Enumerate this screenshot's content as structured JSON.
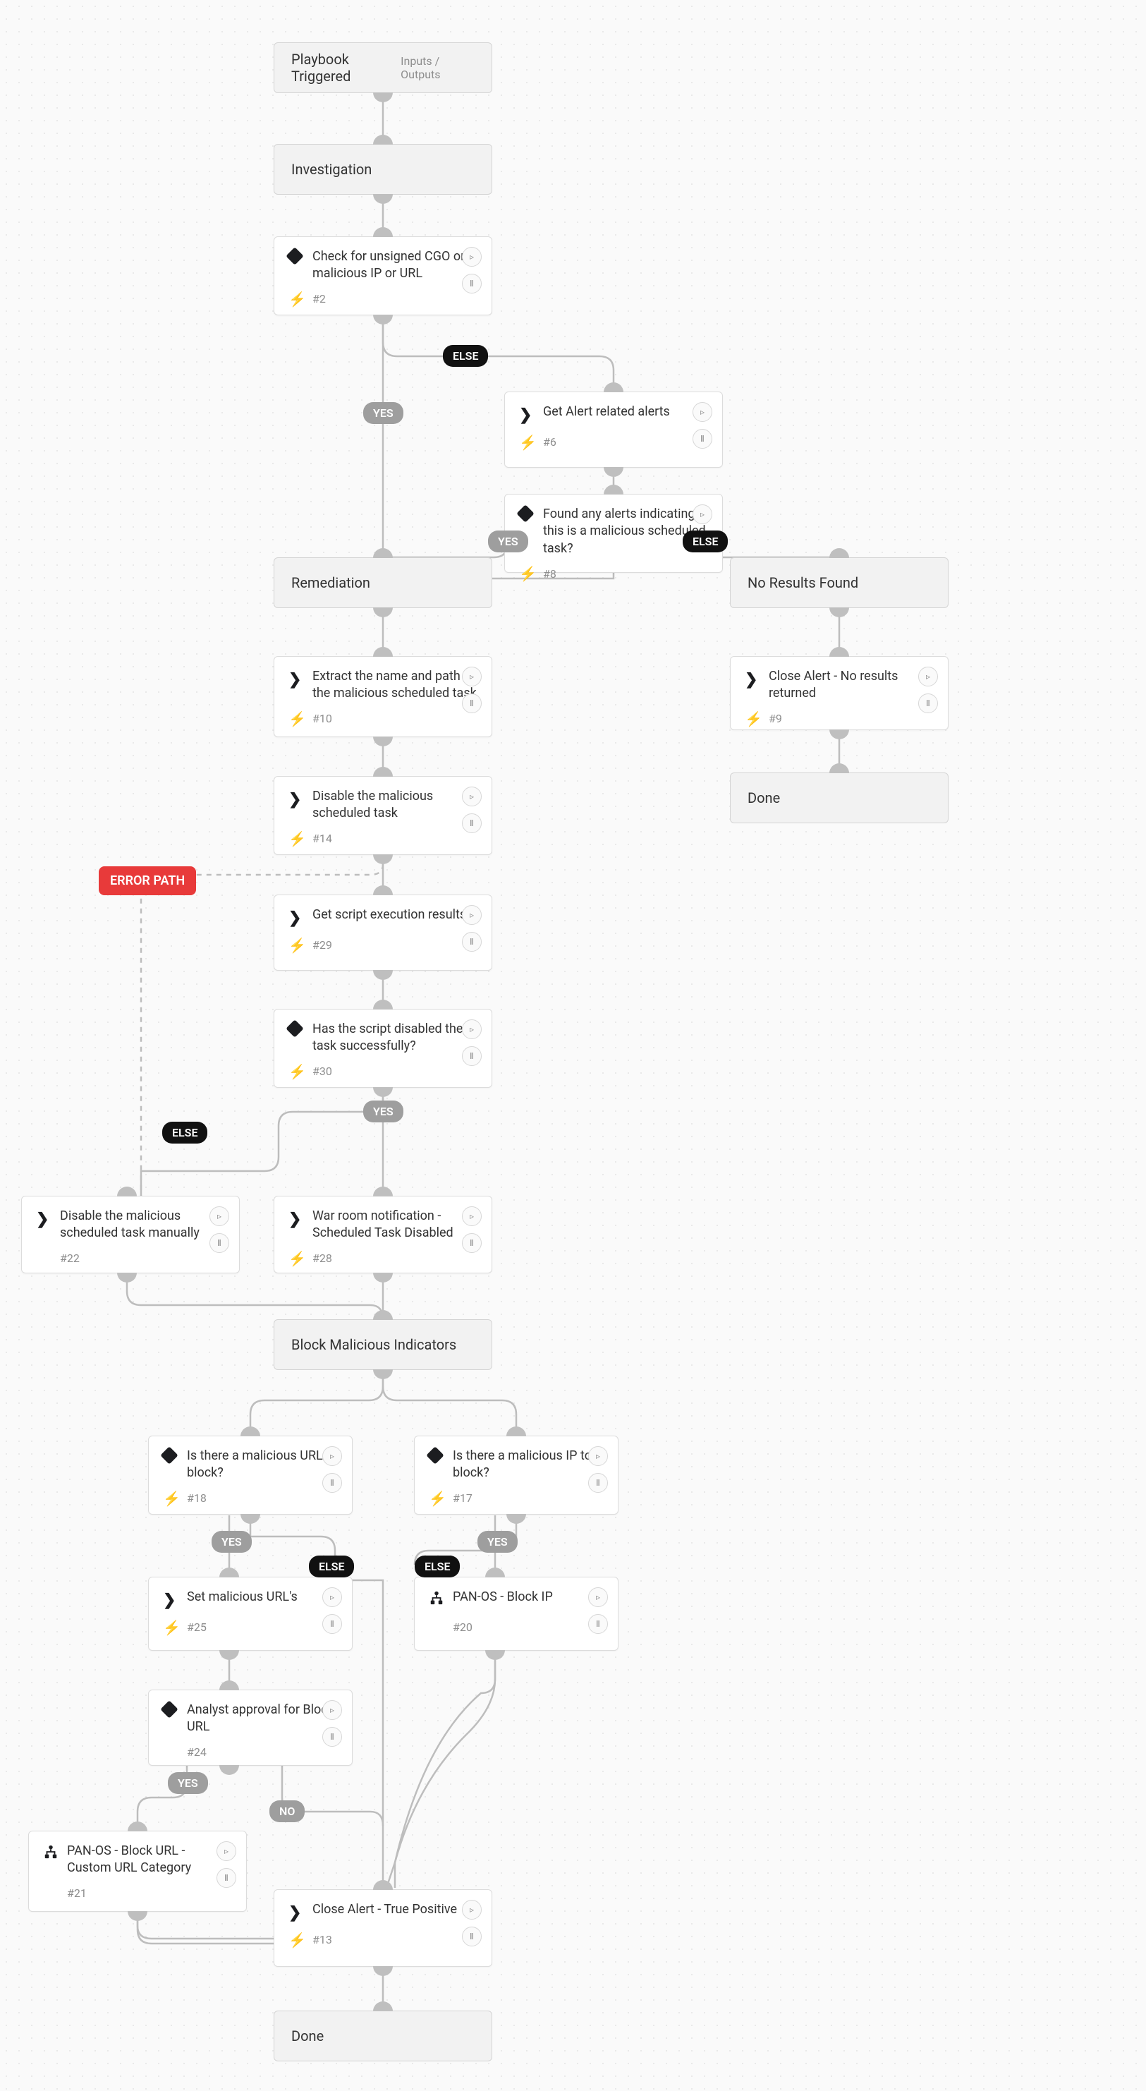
{
  "chart_data": {
    "type": "flowchart",
    "nodes": [
      {
        "id": "start",
        "kind": "section",
        "label": "Playbook Triggered",
        "right": "Inputs / Outputs"
      },
      {
        "id": "investigation",
        "kind": "section",
        "label": "Investigation"
      },
      {
        "id": "n2",
        "kind": "condition",
        "label": "Check for unsigned CGO or malicious IP or URL",
        "tid": "#2"
      },
      {
        "id": "n6",
        "kind": "task",
        "label": "Get Alert related alerts",
        "tid": "#6"
      },
      {
        "id": "n8",
        "kind": "condition",
        "label": "Found any alerts indicating this is a malicious scheduled task?",
        "tid": "#8"
      },
      {
        "id": "remediation",
        "kind": "section",
        "label": "Remediation"
      },
      {
        "id": "noresults",
        "kind": "section",
        "label": "No Results Found"
      },
      {
        "id": "n10",
        "kind": "task",
        "label": "Extract the name and path of the malicious scheduled task",
        "tid": "#10"
      },
      {
        "id": "n9",
        "kind": "task",
        "label": "Close Alert - No results returned",
        "tid": "#9"
      },
      {
        "id": "done_r",
        "kind": "section",
        "label": "Done"
      },
      {
        "id": "n14",
        "kind": "task",
        "label": "Disable the malicious scheduled task",
        "tid": "#14"
      },
      {
        "id": "n29",
        "kind": "task",
        "label": "Get script execution results",
        "tid": "#29"
      },
      {
        "id": "n30",
        "kind": "condition",
        "label": "Has the script disabled the task successfully?",
        "tid": "#30"
      },
      {
        "id": "n22",
        "kind": "task",
        "label": "Disable the malicious scheduled task manually",
        "tid": "#22"
      },
      {
        "id": "n28",
        "kind": "task",
        "label": "War room notification - Scheduled Task Disabled",
        "tid": "#28"
      },
      {
        "id": "blockind",
        "kind": "section",
        "label": "Block Malicious Indicators"
      },
      {
        "id": "n18",
        "kind": "condition",
        "label": "Is there a malicious URL to block?",
        "tid": "#18"
      },
      {
        "id": "n17",
        "kind": "condition",
        "label": "Is there a malicious IP to block?",
        "tid": "#17"
      },
      {
        "id": "n25",
        "kind": "task",
        "label": "Set malicious URL's",
        "tid": "#25"
      },
      {
        "id": "n20",
        "kind": "subplay",
        "label": "PAN-OS - Block IP",
        "tid": "#20"
      },
      {
        "id": "n24",
        "kind": "condition",
        "label": "Analyst approval for Block URL",
        "tid": "#24"
      },
      {
        "id": "n21",
        "kind": "subplay",
        "label": "PAN-OS - Block URL - Custom URL Category",
        "tid": "#21"
      },
      {
        "id": "n13",
        "kind": "task",
        "label": "Close Alert - True Positive",
        "tid": "#13"
      },
      {
        "id": "done",
        "kind": "section",
        "label": "Done"
      }
    ],
    "edges": [
      {
        "from": "start",
        "to": "investigation"
      },
      {
        "from": "investigation",
        "to": "n2"
      },
      {
        "from": "n2",
        "to": "remediation",
        "label": "YES"
      },
      {
        "from": "n2",
        "to": "n6",
        "label": "ELSE"
      },
      {
        "from": "n6",
        "to": "n8"
      },
      {
        "from": "n8",
        "to": "remediation",
        "label": "YES"
      },
      {
        "from": "n8",
        "to": "noresults",
        "label": "ELSE"
      },
      {
        "from": "remediation",
        "to": "n10"
      },
      {
        "from": "noresults",
        "to": "n9"
      },
      {
        "from": "n9",
        "to": "done_r"
      },
      {
        "from": "n10",
        "to": "n14"
      },
      {
        "from": "n14",
        "to": "n29"
      },
      {
        "from": "n14",
        "to": "n22",
        "label": "ERROR PATH",
        "style": "dashed"
      },
      {
        "from": "n29",
        "to": "n30"
      },
      {
        "from": "n30",
        "to": "n28",
        "label": "YES"
      },
      {
        "from": "n30",
        "to": "n22",
        "label": "ELSE"
      },
      {
        "from": "n22",
        "to": "blockind"
      },
      {
        "from": "n28",
        "to": "blockind"
      },
      {
        "from": "blockind",
        "to": "n18"
      },
      {
        "from": "blockind",
        "to": "n17"
      },
      {
        "from": "n18",
        "to": "n25",
        "label": "YES"
      },
      {
        "from": "n18",
        "to": "n13",
        "label": "ELSE"
      },
      {
        "from": "n17",
        "to": "n20",
        "label": "YES"
      },
      {
        "from": "n17",
        "to": "n13",
        "label": "ELSE"
      },
      {
        "from": "n25",
        "to": "n24"
      },
      {
        "from": "n24",
        "to": "n21",
        "label": "YES"
      },
      {
        "from": "n24",
        "to": "n13",
        "label": "NO"
      },
      {
        "from": "n20",
        "to": "n13"
      },
      {
        "from": "n21",
        "to": "n13"
      },
      {
        "from": "n13",
        "to": "done"
      }
    ]
  },
  "labels": {
    "error_path": "ERROR PATH",
    "yes": "YES",
    "no": "NO",
    "else": "ELSE"
  }
}
